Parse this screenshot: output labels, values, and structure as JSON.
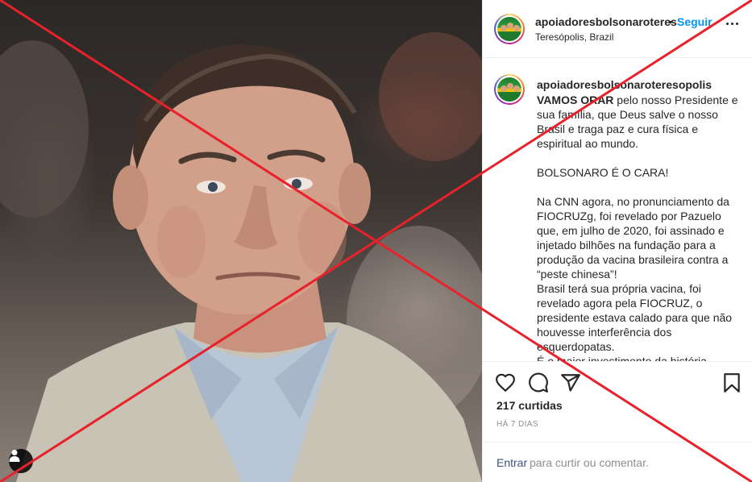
{
  "post": {
    "photo_icon": "person-portrait-photo",
    "tag_icon": "user-tag-icon"
  },
  "header": {
    "username": "apoiadoresbolsonaroteres",
    "separator": "•",
    "follow_label": "Seguir",
    "location": "Teresópolis, Brazil",
    "more_icon": "ellipsis-icon"
  },
  "caption": {
    "username": "apoiadoresbolsonaroteresopolis",
    "lead_bold": "VAMOS ORAR",
    "body": " pelo nosso Presidente e sua família, que Deus salve o nosso Brasil e traga paz e cura física e espiritual ao mundo.\n\nBOLSONARO É O CARA!\n\nNa CNN agora, no pronunciamento da FIOCRUZg, foi revelado por Pazuelo que, em julho de 2020, foi assinado e injetado bilhões na fundação para a produção da vacina brasileira contra a “peste chinesa”!\nBrasil terá sua própria vacina, foi revelado agora pela FIOCRUZ, o presidente estava calado para que não houvesse interferência dos esquerdopatas.\nÉ o maior investimento da história"
  },
  "actions": {
    "like_icon": "heart-icon",
    "comment_icon": "comment-bubble-icon",
    "share_icon": "paper-plane-icon",
    "save_icon": "bookmark-icon",
    "likes": "217 curtidas",
    "time_ago": "HÁ 7 DIAS"
  },
  "comment": {
    "login_label": "Entrar",
    "placeholder": "para curtir ou comentar."
  },
  "overlay": {
    "mark": "red-x-overlay",
    "color": "#e8212b"
  }
}
